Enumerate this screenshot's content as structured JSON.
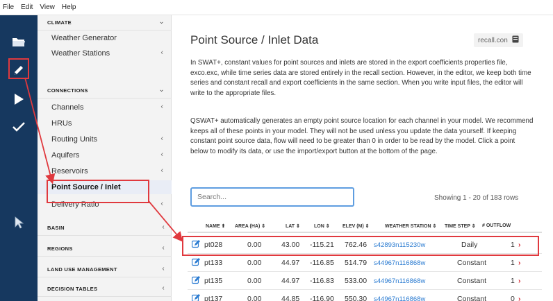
{
  "menu": [
    "File",
    "Edit",
    "View",
    "Help"
  ],
  "rail": {
    "icons": [
      "folder-icon",
      "pencil-icon",
      "play-icon",
      "check-icon"
    ],
    "cursor_icon": "mouse-cursor-icon"
  },
  "sidebar": {
    "sections": {
      "climate": "CLIMATE",
      "connections": "CONNECTIONS",
      "basin": "BASIN",
      "regions": "REGIONS",
      "land_use": "LAND USE MANAGEMENT",
      "decision_tables": "DECISION TABLES"
    },
    "climate_items": [
      "Weather Generator",
      "Weather Stations"
    ],
    "connection_items": [
      "Channels",
      "HRUs",
      "Routing Units",
      "Aquifers",
      "Reservoirs",
      "Point Source / Inlet",
      "Delivery Ratio"
    ],
    "chevron_down": "⌄",
    "chevron_left": "‹"
  },
  "main": {
    "title": "Point Source / Inlet Data",
    "recall_file": "recall.con",
    "para1": "In SWAT+, constant values for point sources and inlets are stored in the export coefficients properties file, exco.exc, while time series data are stored entirely in the recall section. However, in the editor, we keep both time series and constant recall and export coefficients in the same section. When you write input files, the editor will write to the appropriate files.",
    "para2": "QSWAT+ automatically generates an empty point source location for each channel in your model. We recommend keeps all of these points in your model. They will not be used unless you update the data yourself. If keeping constant point source data, flow will need to be greater than 0 in order to be read by the model. Click a point below to modify its data, or use the import/export button at the bottom of the page.",
    "search_placeholder": "Search...",
    "showing": "Showing 1 - 20 of 183 rows"
  },
  "table": {
    "headers": [
      "NAME ⬆",
      "AREA (HA) ⇕",
      "LAT ⇕",
      "LON ⇕",
      "ELEV (M) ⇕",
      "WEATHER STATION ⇕",
      "TIME STEP ⇕",
      "# OUTFLOW"
    ],
    "rows": [
      {
        "name": "pt028",
        "area": "0.00",
        "lat": "43.00",
        "lon": "-115.21",
        "elev": "762.46",
        "station": "s42893n115230w",
        "step": "Daily",
        "outflow": "1",
        "go": "›"
      },
      {
        "name": "pt133",
        "area": "0.00",
        "lat": "44.97",
        "lon": "-116.85",
        "elev": "514.79",
        "station": "s44967n116868w",
        "step": "Constant",
        "outflow": "1",
        "go": "›"
      },
      {
        "name": "pt135",
        "area": "0.00",
        "lat": "44.97",
        "lon": "-116.83",
        "elev": "533.00",
        "station": "s44967n116868w",
        "step": "Constant",
        "outflow": "1",
        "go": "›"
      },
      {
        "name": "pt137",
        "area": "0.00",
        "lat": "44.85",
        "lon": "-116.90",
        "elev": "550.30",
        "station": "s44967n116868w",
        "step": "Constant",
        "outflow": "0",
        "go": "›"
      }
    ]
  },
  "colors": {
    "rail": "#16385f",
    "annotation": "#e0393e",
    "link": "#2a7bd1",
    "focus": "#5e9de0"
  }
}
